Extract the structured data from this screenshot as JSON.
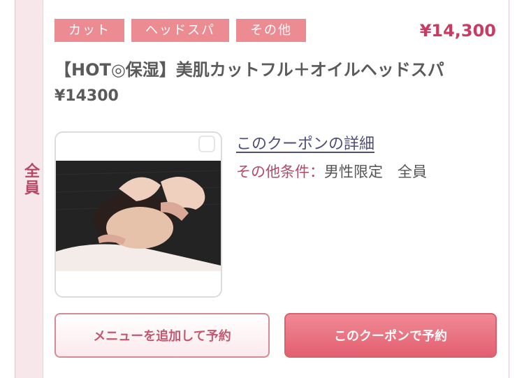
{
  "side_label": "全員",
  "tags": [
    "カット",
    "ヘッドスパ",
    "その他"
  ],
  "price_display": "¥14,300",
  "title": "【HOT◎保湿】美肌カットフル＋オイルヘッドスパ",
  "price_sub": "¥14300",
  "coupon_link": "このクーポンの詳細",
  "conditions": {
    "label": "その他条件：",
    "value": "男性限定　全員"
  },
  "buttons": {
    "add_menu": "メニューを追加して予約",
    "reserve": "このクーポンで予約"
  },
  "colors": {
    "accent": "#c93b63",
    "tag_bg": "#ec8c92",
    "side_band": "#f7e6ea",
    "reserve_btn": "#e35f70"
  }
}
